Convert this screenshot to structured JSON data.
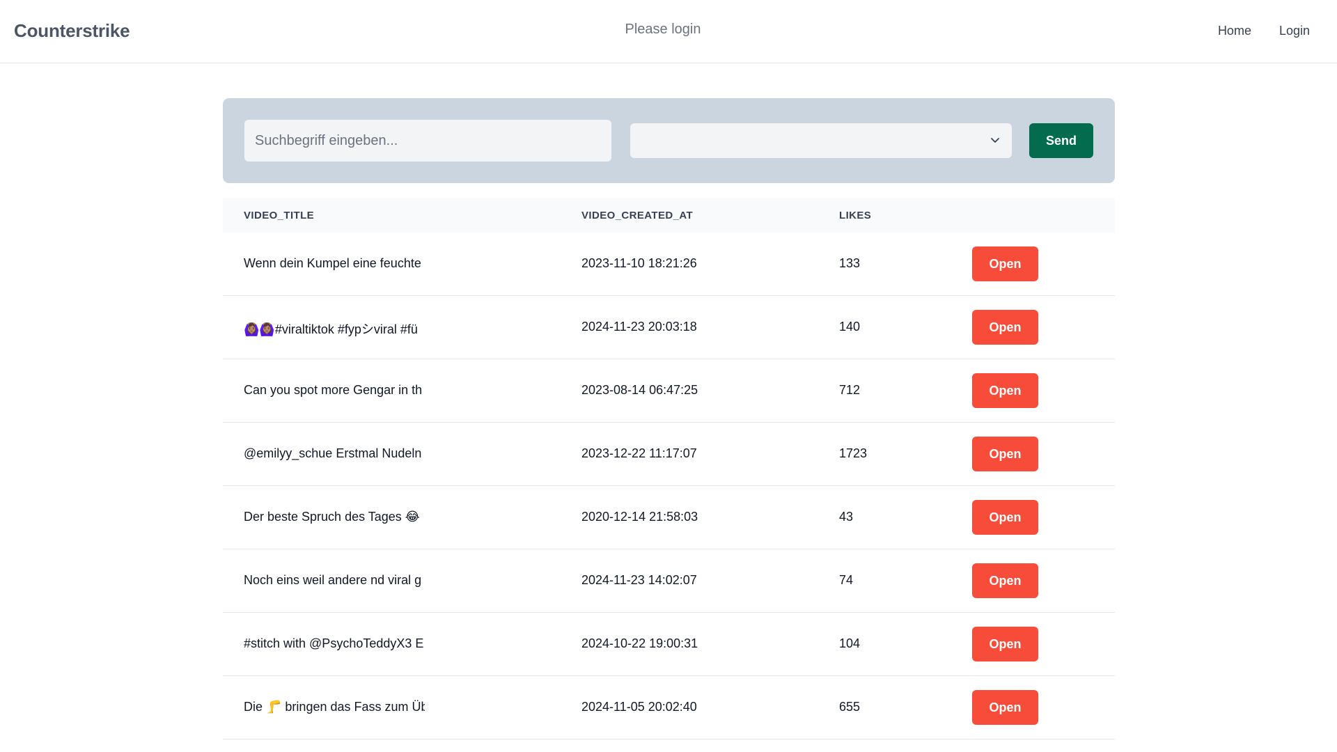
{
  "navbar": {
    "brand": "Counterstrike",
    "message": "Please login",
    "links": [
      "Home",
      "Login"
    ]
  },
  "search": {
    "placeholder": "Suchbegriff eingeben...",
    "value": "",
    "select_value": "",
    "send_label": "Send"
  },
  "table": {
    "headers": [
      "VIDEO_TITLE",
      "VIDEO_CREATED_AT",
      "LIKES"
    ],
    "open_label": "Open",
    "rows": [
      {
        "title": "Wenn dein Kumpel eine feuchte",
        "created_at": "2023-11-10 18:21:26",
        "likes": "133"
      },
      {
        "title": "🙆🏽‍♀️🙆🏽‍♀️#viraltiktok #fypシviral #fü",
        "created_at": "2024-11-23 20:03:18",
        "likes": "140"
      },
      {
        "title": "Can you spot more Gengar in th",
        "created_at": "2023-08-14 06:47:25",
        "likes": "712"
      },
      {
        "title": "@emilyy_schue Erstmal Nudeln",
        "created_at": "2023-12-22 11:17:07",
        "likes": "1723"
      },
      {
        "title": "Der beste Spruch des Tages 😂",
        "created_at": "2020-12-14 21:58:03",
        "likes": "43"
      },
      {
        "title": "Noch eins weil andere nd viral g",
        "created_at": "2024-11-23 14:02:07",
        "likes": "74"
      },
      {
        "title": "#stitch with @PsychoTeddyX3 E",
        "created_at": "2024-10-22 19:00:31",
        "likes": "104"
      },
      {
        "title": "Die 🦵 bringen das Fass zum Üb",
        "created_at": "2024-11-05 20:02:40",
        "likes": "655"
      }
    ]
  },
  "colors": {
    "send": "#046c4e",
    "open": "#f84c3a",
    "panel": "#cbd5df"
  }
}
